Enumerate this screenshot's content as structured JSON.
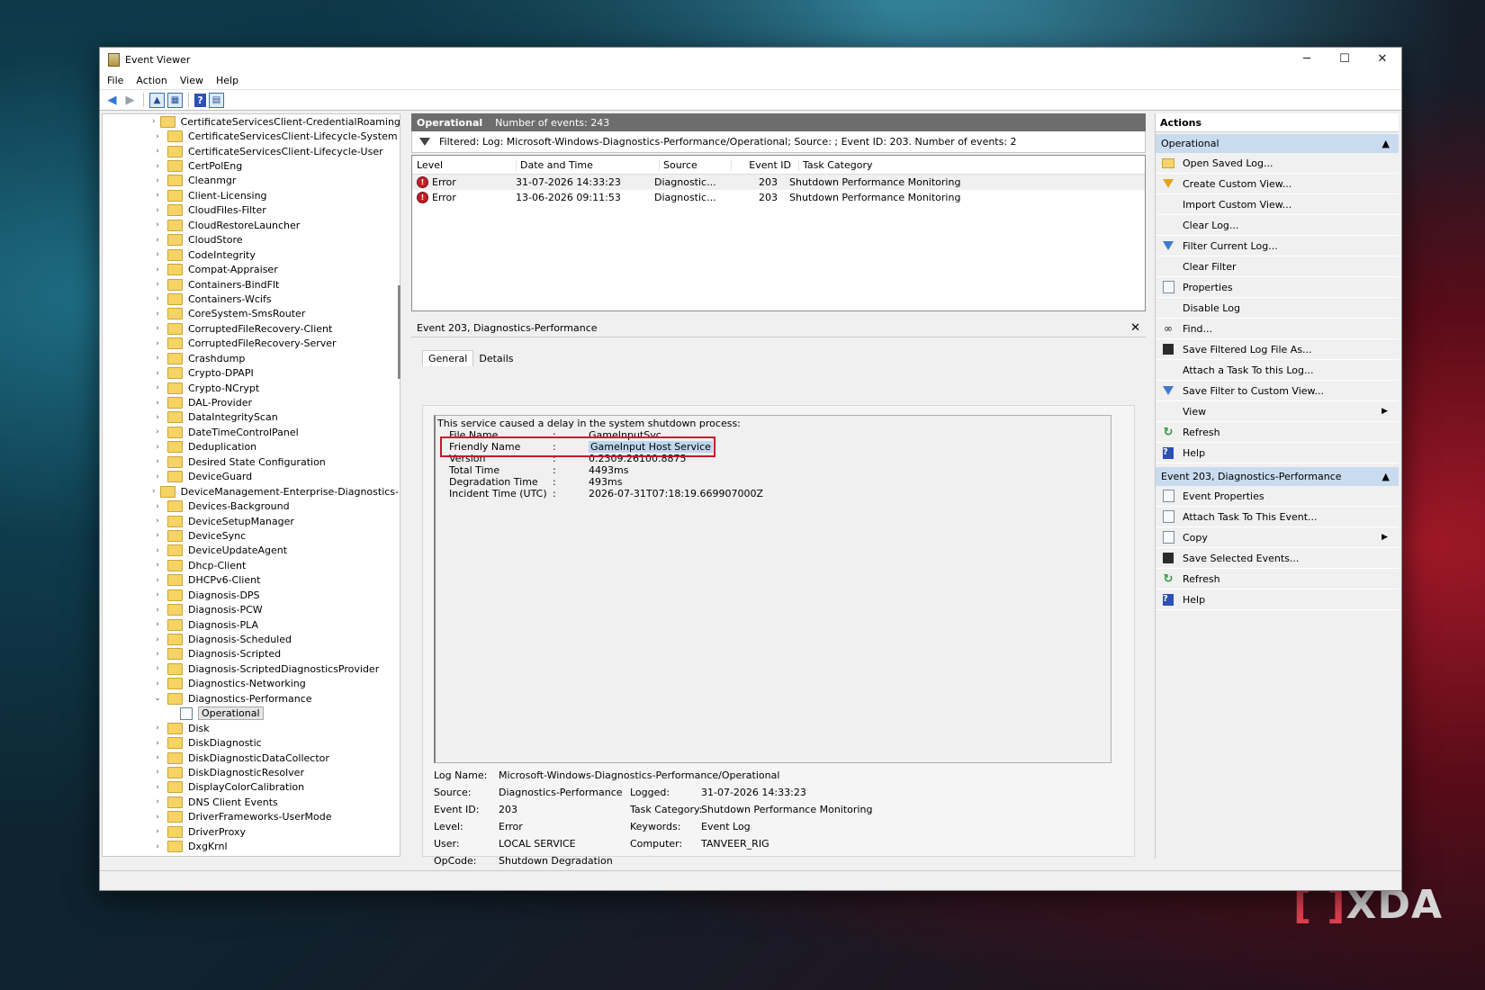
{
  "window": {
    "title": "Event Viewer",
    "controls": [
      "─",
      "☐",
      "✕"
    ]
  },
  "menu": [
    "File",
    "Action",
    "View",
    "Help"
  ],
  "tree": {
    "items": [
      "CertificateServicesClient-CredentialRoaming",
      "CertificateServicesClient-Lifecycle-System",
      "CertificateServicesClient-Lifecycle-User",
      "CertPolEng",
      "Cleanmgr",
      "Client-Licensing",
      "CloudFiles-Filter",
      "CloudRestoreLauncher",
      "CloudStore",
      "CodeIntegrity",
      "Compat-Appraiser",
      "Containers-BindFlt",
      "Containers-Wcifs",
      "CoreSystem-SmsRouter",
      "CorruptedFileRecovery-Client",
      "CorruptedFileRecovery-Server",
      "Crashdump",
      "Crypto-DPAPI",
      "Crypto-NCrypt",
      "DAL-Provider",
      "DataIntegrityScan",
      "DateTimeControlPanel",
      "Deduplication",
      "Desired State Configuration",
      "DeviceGuard",
      "DeviceManagement-Enterprise-Diagnostics-Pro",
      "Devices-Background",
      "DeviceSetupManager",
      "DeviceSync",
      "DeviceUpdateAgent",
      "Dhcp-Client",
      "DHCPv6-Client",
      "Diagnosis-DPS",
      "Diagnosis-PCW",
      "Diagnosis-PLA",
      "Diagnosis-Scheduled",
      "Diagnosis-Scripted",
      "Diagnosis-ScriptedDiagnosticsProvider",
      "Diagnostics-Networking"
    ],
    "expanded": "Diagnostics-Performance",
    "selected_leaf": "Operational",
    "items_after": [
      "Disk",
      "DiskDiagnostic",
      "DiskDiagnosticDataCollector",
      "DiskDiagnosticResolver",
      "DisplayColorCalibration",
      "DNS Client Events",
      "DriverFrameworks-UserMode",
      "DriverProxy",
      "DxgKrnl"
    ]
  },
  "log_header": {
    "name": "Operational",
    "count_text": "Number of events: 243"
  },
  "filter_text": "Filtered: Log: Microsoft-Windows-Diagnostics-Performance/Operational; Source: ; Event ID: 203. Number of events: 2",
  "grid": {
    "columns": [
      "Level",
      "Date and Time",
      "Source",
      "Event ID",
      "Task Category"
    ],
    "rows": [
      {
        "level": "Error",
        "datetime": "31-07-2026 14:33:23",
        "source": "Diagnostic...",
        "event_id": "203",
        "task": "Shutdown Performance Monitoring"
      },
      {
        "level": "Error",
        "datetime": "13-06-2026 09:11:53",
        "source": "Diagnostic...",
        "event_id": "203",
        "task": "Shutdown Performance Monitoring"
      }
    ]
  },
  "detail": {
    "title": "Event 203, Diagnostics-Performance",
    "tabs": [
      "General",
      "Details"
    ],
    "description_line": "This service caused a delay in the system shutdown process:",
    "fields": [
      {
        "key": "File Name",
        "value": "GameInputSvc"
      },
      {
        "key": "Friendly Name",
        "value": "GameInput Host Service"
      },
      {
        "key": "Version",
        "value": "0.2309.26100.8875"
      },
      {
        "key": "Total Time",
        "value": "4493ms"
      },
      {
        "key": "Degradation Time",
        "value": "493ms"
      },
      {
        "key": "Incident Time (UTC)",
        "value": "2026-07-31T07:18:19.669907000Z"
      }
    ],
    "separator": ":",
    "props": {
      "log_name_label": "Log Name:",
      "log_name": "Microsoft-Windows-Diagnostics-Performance/Operational",
      "source_label": "Source:",
      "source": "Diagnostics-Performance",
      "logged_label": "Logged:",
      "logged": "31-07-2026 14:33:23",
      "event_id_label": "Event ID:",
      "event_id": "203",
      "task_label": "Task Category:",
      "task": "Shutdown Performance Monitoring",
      "level_label": "Level:",
      "level": "Error",
      "keywords_label": "Keywords:",
      "keywords": "Event Log",
      "user_label": "User:",
      "user": "LOCAL SERVICE",
      "computer_label": "Computer:",
      "computer": "TANVEER_RIG",
      "opcode_label": "OpCode:",
      "opcode": "Shutdown Degradation"
    }
  },
  "actions": {
    "title": "Actions",
    "section1": "Operational",
    "items1": [
      {
        "label": "Open Saved Log...",
        "icon": "folder-open-icon"
      },
      {
        "label": "Create Custom View...",
        "icon": "funnel-gold-icon"
      },
      {
        "label": "Import Custom View...",
        "icon": ""
      },
      {
        "label": "Clear Log...",
        "icon": ""
      },
      {
        "label": "Filter Current Log...",
        "icon": "funnel-icon"
      },
      {
        "label": "Clear Filter",
        "icon": ""
      },
      {
        "label": "Properties",
        "icon": "properties-icon"
      },
      {
        "label": "Disable Log",
        "icon": ""
      },
      {
        "label": "Find...",
        "icon": "binoculars-icon"
      },
      {
        "label": "Save Filtered Log File As...",
        "icon": "save-icon"
      },
      {
        "label": "Attach a Task To this Log...",
        "icon": ""
      },
      {
        "label": "Save Filter to Custom View...",
        "icon": "save-filter-icon"
      },
      {
        "label": "View",
        "icon": "",
        "submenu": true
      },
      {
        "label": "Refresh",
        "icon": "refresh-icon"
      },
      {
        "label": "Help",
        "icon": "help-icon"
      }
    ],
    "section2": "Event 203, Diagnostics-Performance",
    "items2": [
      {
        "label": "Event Properties",
        "icon": "properties-icon"
      },
      {
        "label": "Attach Task To This Event...",
        "icon": "task-icon"
      },
      {
        "label": "Copy",
        "icon": "copy-icon",
        "submenu": true
      },
      {
        "label": "Save Selected Events...",
        "icon": "save-icon"
      },
      {
        "label": "Refresh",
        "icon": "refresh-icon"
      },
      {
        "label": "Help",
        "icon": "help-icon"
      }
    ]
  },
  "watermark": "XDA"
}
